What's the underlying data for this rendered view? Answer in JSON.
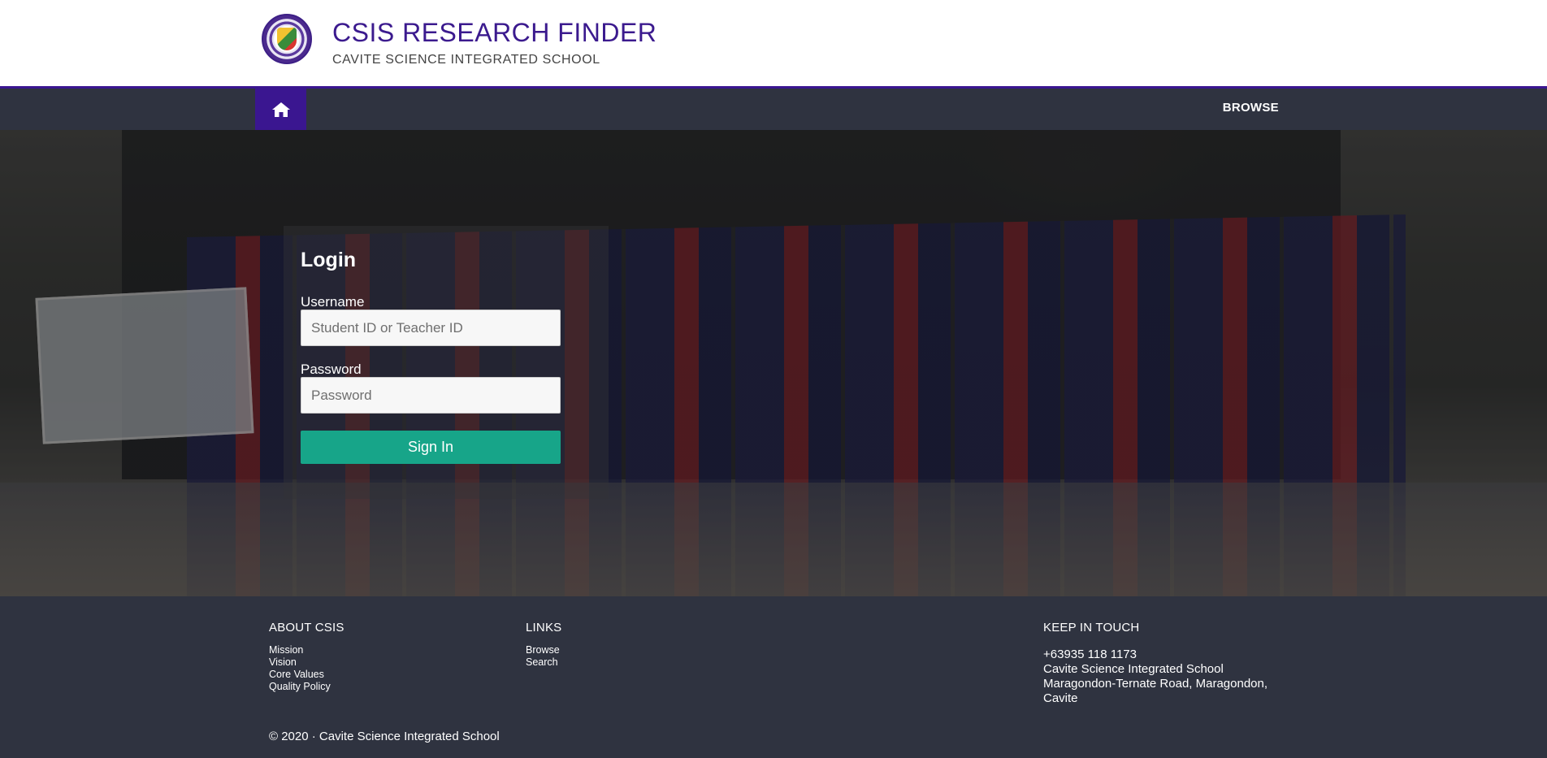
{
  "header": {
    "title": "CSIS RESEARCH FINDER",
    "subtitle": "CAVITE SCIENCE INTEGRATED SCHOOL",
    "logo_icon": "school-seal-logo"
  },
  "nav": {
    "home_icon": "home-icon",
    "browse_label": "BROWSE"
  },
  "login": {
    "title": "Login",
    "username_label": "Username",
    "username_placeholder": "Student ID or Teacher ID",
    "password_label": "Password",
    "password_placeholder": "Password",
    "signin_label": "Sign In"
  },
  "footer": {
    "about": {
      "heading": "ABOUT CSIS",
      "links": [
        "Mission",
        "Vision",
        "Core Values",
        "Quality Policy"
      ]
    },
    "links": {
      "heading": "LINKS",
      "links": [
        "Browse",
        "Search"
      ]
    },
    "contact": {
      "heading": "KEEP IN TOUCH",
      "phone": "+63935 118 1173",
      "school": "Cavite Science Integrated School",
      "address_line1": "Maragondon-Ternate Road, Maragondon,",
      "address_line2": "Cavite"
    },
    "copyright": "© 2020 · Cavite Science Integrated School"
  },
  "colors": {
    "brand_purple": "#3a1690",
    "nav_bg": "#2f3340",
    "signin_green": "#17a589"
  }
}
